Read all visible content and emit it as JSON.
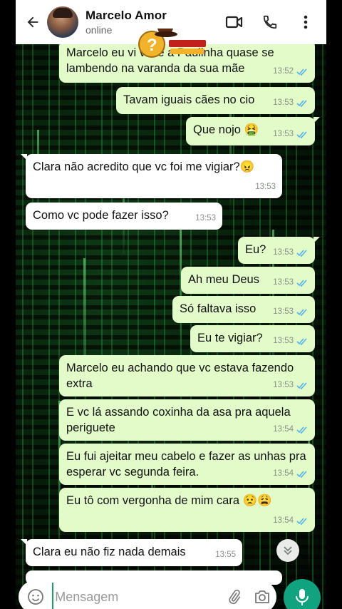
{
  "header": {
    "contact_name": "Marcelo Amor",
    "status": "online",
    "icons": {
      "back": "back-arrow-icon",
      "video": "video-call-icon",
      "call": "phone-call-icon",
      "menu": "more-vert-icon"
    }
  },
  "messages": [
    {
      "dir": "out",
      "text": "Marcelo eu vi você a Paulinha quase se lambendo na varanda da sua mãe",
      "time": "13:52",
      "read": true
    },
    {
      "dir": "out",
      "text": "Tavam iguais cães no cio",
      "time": "13:53",
      "read": true
    },
    {
      "dir": "out",
      "text": "Que nojo 🤮",
      "time": "13:53",
      "read": true
    },
    {
      "dir": "in",
      "text": "Clara não acredito que vc foi me vigiar?😠",
      "time": "13:53"
    },
    {
      "dir": "in",
      "text": "Como vc pode fazer isso?",
      "time": "13:53"
    },
    {
      "dir": "out",
      "text": "Eu?",
      "time": "13:53",
      "read": true
    },
    {
      "dir": "out",
      "text": "Ah meu Deus",
      "time": "13:53",
      "read": true
    },
    {
      "dir": "out",
      "text": "Só faltava isso",
      "time": "13:53",
      "read": true
    },
    {
      "dir": "out",
      "text": "Eu te vigiar?",
      "time": "13:53",
      "read": true
    },
    {
      "dir": "out",
      "text": "Marcelo eu achando que vc estava fazendo extra",
      "time": "13:53",
      "read": true
    },
    {
      "dir": "out",
      "text": "E vc lá assando coxinha da asa pra aquela periguete",
      "time": "13:54",
      "read": true
    },
    {
      "dir": "out",
      "text": "Eu fui ajeitar meu cabelo e fazer as unhas pra esperar vc segunda feira.",
      "time": "13:54",
      "read": true
    },
    {
      "dir": "out",
      "text": "Eu tô com vergonha de mim cara 😟😩",
      "time": "13:54",
      "read": true
    },
    {
      "dir": "in",
      "text": "Clara eu não fiz nada demais",
      "time": "13:55"
    }
  ],
  "composer": {
    "placeholder": "Mensagem",
    "value": "",
    "icons": {
      "emoji": "emoji-icon",
      "attach": "paperclip-icon",
      "camera": "camera-icon",
      "mic": "mic-icon",
      "scroll": "chevron-double-down-icon"
    }
  },
  "colors": {
    "outgoing_bubble": "#e3fbc9",
    "incoming_bubble": "#ffffff",
    "read_tick": "#4fb6ec",
    "mic_button": "#0fa37f"
  }
}
